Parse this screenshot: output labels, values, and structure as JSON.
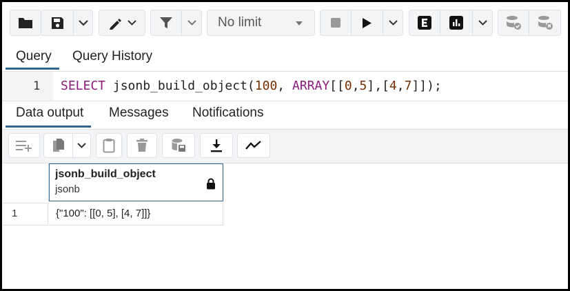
{
  "toolbar": {
    "limit_value": "No limit",
    "icons": [
      "folder-open-icon",
      "save-icon",
      "edit-pen-icon",
      "filter-icon",
      "stop-icon",
      "execute-icon",
      "explain-icon",
      "explain-analyze-icon",
      "commit-icon",
      "rollback-icon"
    ]
  },
  "query_tabs": [
    "Query",
    "Query History"
  ],
  "editor": {
    "line_number": "1",
    "keyword_select": "SELECT",
    "text_func": " jsonb_build_object(",
    "num_100": "100",
    "text_comma": ", ",
    "keyword_array": "ARRAY",
    "text_lb": "[[",
    "n0": "0",
    "c1": ",",
    "n5": "5",
    "mid": "],[",
    "n4": "4",
    "c2": ",",
    "n7": "7",
    "end": "]]);"
  },
  "output_tabs": [
    "Data output",
    "Messages",
    "Notifications"
  ],
  "grid": {
    "column_name": "jsonb_build_object",
    "column_type": "jsonb",
    "rows": [
      {
        "row_number": "1",
        "value": "{\"100\": [[0, 5], [4, 7]]}"
      }
    ]
  },
  "colors": {
    "accent": "#326690",
    "keyword": "#8b1a7d",
    "number": "#7a2d00",
    "toolbar_bg": "#f3f4f6"
  }
}
